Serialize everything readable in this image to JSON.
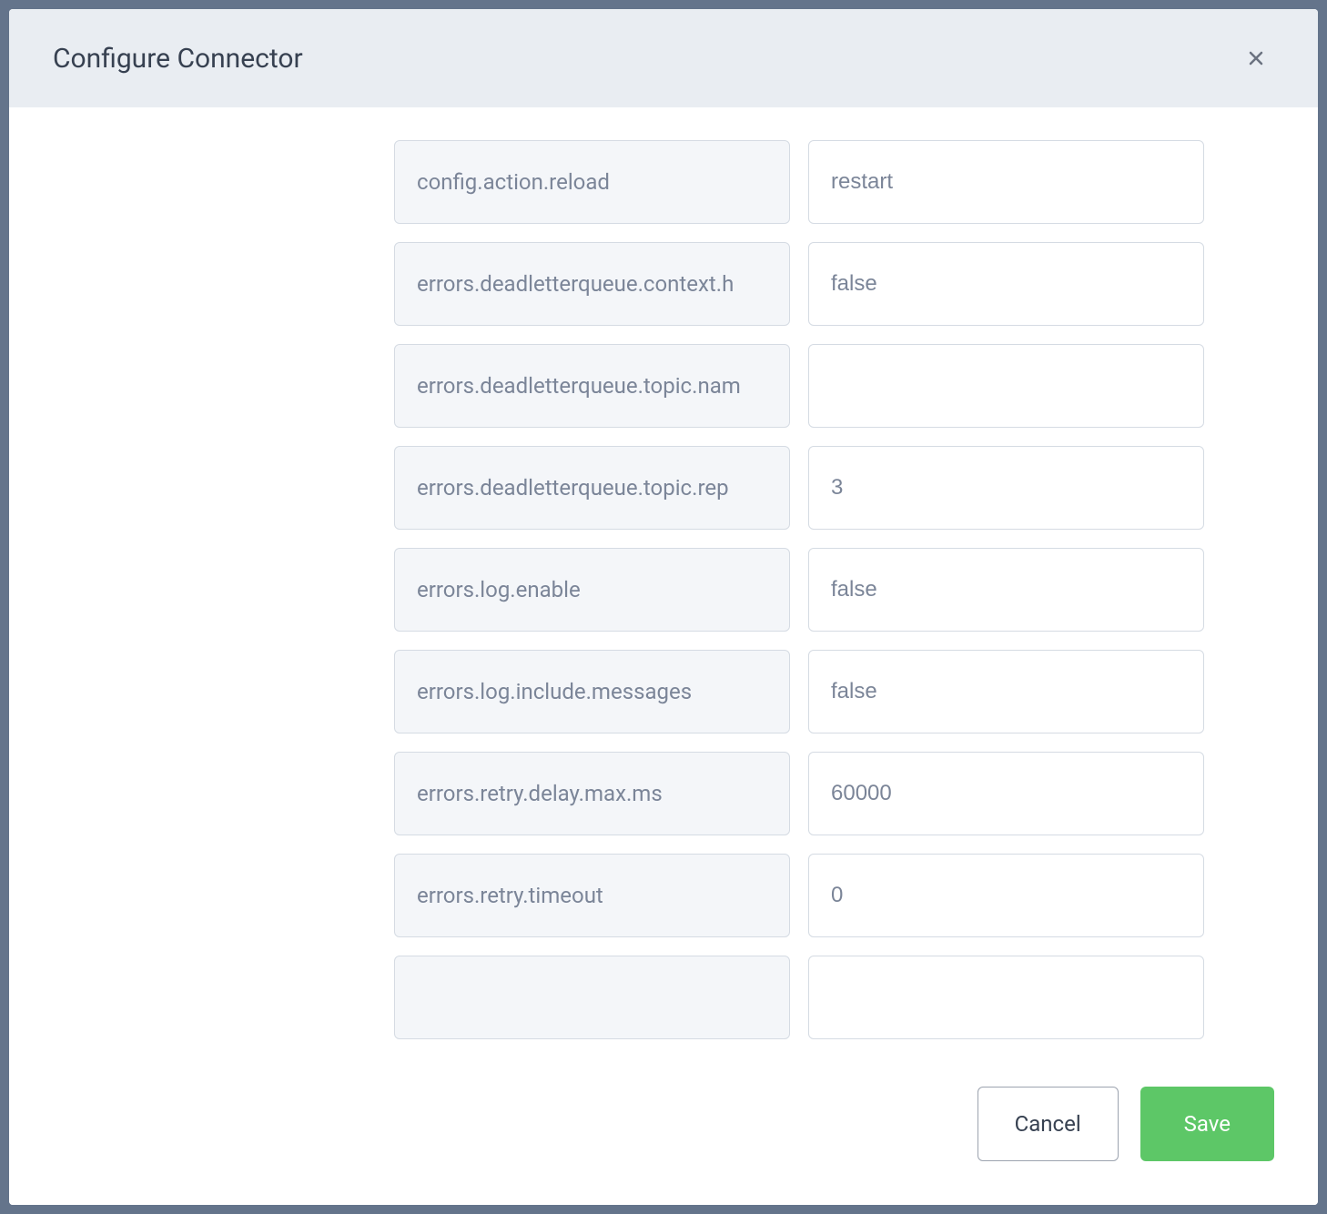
{
  "modal": {
    "title": "Configure Connector",
    "footer": {
      "cancel_label": "Cancel",
      "save_label": "Save"
    }
  },
  "config_rows": [
    {
      "key": "config.action.reload",
      "value": "restart"
    },
    {
      "key": "errors.deadletterqueue.context.h",
      "value": "false"
    },
    {
      "key": "errors.deadletterqueue.topic.nam",
      "value": ""
    },
    {
      "key": "errors.deadletterqueue.topic.rep",
      "value": "3"
    },
    {
      "key": "errors.log.enable",
      "value": "false"
    },
    {
      "key": "errors.log.include.messages",
      "value": "false"
    },
    {
      "key": "errors.retry.delay.max.ms",
      "value": "60000"
    },
    {
      "key": "errors.retry.timeout",
      "value": "0"
    },
    {
      "key": "",
      "value": ""
    }
  ]
}
